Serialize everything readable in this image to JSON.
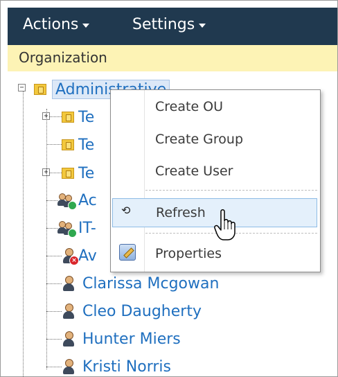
{
  "menubar": {
    "actions_label": "Actions",
    "settings_label": "Settings"
  },
  "orgbar": {
    "label": "Organization"
  },
  "tree": {
    "root_label": "Administrative",
    "items": [
      {
        "label": "Te",
        "type": "ou",
        "expandable": true
      },
      {
        "label": "Te",
        "type": "ou",
        "expandable": false
      },
      {
        "label": "Te",
        "type": "ou",
        "expandable": true
      },
      {
        "label": "Ac",
        "type": "group"
      },
      {
        "label": "IT-",
        "type": "group"
      },
      {
        "label": "Av",
        "type": "user-disabled"
      },
      {
        "label": "Clarissa Mcgowan",
        "type": "user"
      },
      {
        "label": "Cleo Daugherty",
        "type": "user"
      },
      {
        "label": "Hunter Miers",
        "type": "user"
      },
      {
        "label": "Kristi Norris",
        "type": "user"
      }
    ]
  },
  "context_menu": {
    "items": [
      {
        "label": "Create OU"
      },
      {
        "label": "Create Group"
      },
      {
        "label": "Create User"
      },
      {
        "label": "Refresh",
        "icon": "refresh-icon",
        "highlighted": true
      },
      {
        "label": "Properties",
        "icon": "properties-icon"
      }
    ]
  },
  "colors": {
    "menubar_bg": "#20394f",
    "orgbar_bg": "#fdf3b5",
    "link": "#1f6fbf",
    "highlight_bg": "#e4f0fb"
  }
}
